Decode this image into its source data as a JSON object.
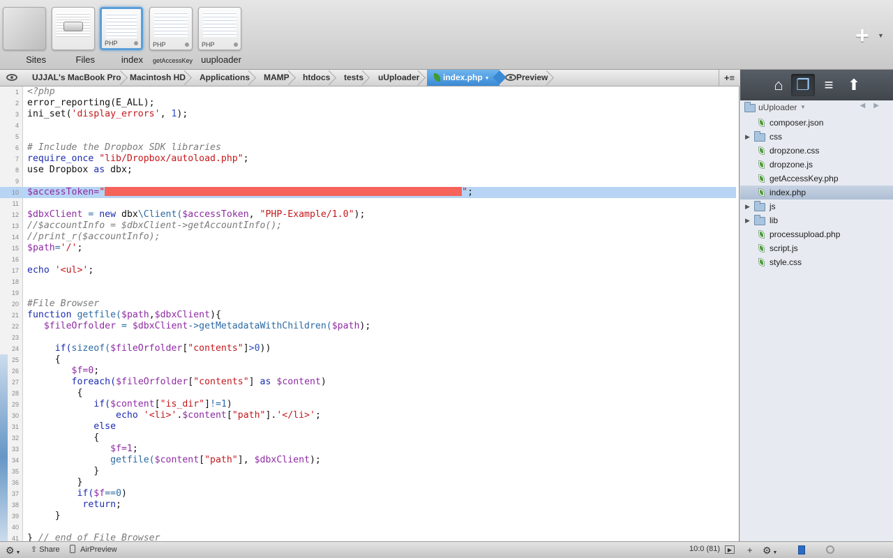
{
  "top_tabs": [
    {
      "label": "Sites",
      "kind": "sites"
    },
    {
      "label": "Files",
      "kind": "files"
    },
    {
      "label": "index",
      "kind": "php",
      "badge": "PHP",
      "selected": true
    },
    {
      "label": "getAccessKey",
      "kind": "php",
      "badge": "PHP"
    },
    {
      "label": "uuploader",
      "kind": "php",
      "badge": "PHP"
    }
  ],
  "new_button_icon": "plus-icon",
  "pathbar": {
    "crumbs": [
      "UJJAL's MacBook Pro",
      "Macintosh HD",
      "Applications",
      "MAMP",
      "htdocs",
      "tests",
      "uUploader"
    ],
    "current_file": "index.php",
    "preview_label": "Preview",
    "add_label": "+≡"
  },
  "editor": {
    "highlighted_line": 10,
    "lines": [
      [
        {
          "t": "<?php",
          "c": "cm"
        }
      ],
      [
        {
          "t": "error_reporting(E_ALL);",
          "c": ""
        }
      ],
      [
        {
          "t": "ini_set(",
          "c": ""
        },
        {
          "t": "'display_errors'",
          "c": "str"
        },
        {
          "t": ", ",
          "c": ""
        },
        {
          "t": "1",
          "c": "num"
        },
        {
          "t": ");",
          "c": ""
        }
      ],
      [],
      [],
      [
        {
          "t": "# Include the Dropbox SDK libraries",
          "c": "cm"
        }
      ],
      [
        {
          "t": "require_once ",
          "c": "kw"
        },
        {
          "t": "\"lib/Dropbox/autoload.php\"",
          "c": "str"
        },
        {
          "t": ";",
          "c": ""
        }
      ],
      [
        {
          "t": "use Dropbox ",
          "c": ""
        },
        {
          "t": "as",
          "c": "kw"
        },
        {
          "t": " dbx;",
          "c": ""
        }
      ],
      [],
      [
        {
          "t": "$accessToken=",
          "c": "var"
        },
        {
          "t": "\"",
          "c": "str"
        },
        {
          "t": "",
          "c": "redact"
        },
        {
          "t": "\"",
          "c": "str"
        },
        {
          "t": ";",
          "c": ""
        }
      ],
      [],
      [
        {
          "t": "$dbxClient",
          "c": "var"
        },
        {
          "t": " = ",
          "c": "fn"
        },
        {
          "t": "new",
          "c": "kw"
        },
        {
          "t": " dbx",
          "c": ""
        },
        {
          "t": "\\Client(",
          "c": "fn"
        },
        {
          "t": "$accessToken",
          "c": "var"
        },
        {
          "t": ", ",
          "c": ""
        },
        {
          "t": "\"PHP-Example/1.0\"",
          "c": "str"
        },
        {
          "t": ");",
          "c": ""
        }
      ],
      [
        {
          "t": "//$accountInfo = $dbxClient->getAccountInfo();",
          "c": "cm"
        }
      ],
      [
        {
          "t": "//print_r($accountInfo);",
          "c": "cm"
        }
      ],
      [
        {
          "t": "$path",
          "c": "var"
        },
        {
          "t": "=",
          "c": "fn"
        },
        {
          "t": "'/'",
          "c": "str"
        },
        {
          "t": ";",
          "c": ""
        }
      ],
      [],
      [
        {
          "t": "echo ",
          "c": "kw"
        },
        {
          "t": "'<ul>'",
          "c": "str"
        },
        {
          "t": ";",
          "c": ""
        }
      ],
      [],
      [],
      [
        {
          "t": "#File Browser",
          "c": "cm"
        }
      ],
      [
        {
          "t": "function ",
          "c": "kw"
        },
        {
          "t": "getfile(",
          "c": "fn"
        },
        {
          "t": "$path",
          "c": "var"
        },
        {
          "t": ",",
          "c": ""
        },
        {
          "t": "$dbxClient",
          "c": "var"
        },
        {
          "t": "){",
          "c": ""
        }
      ],
      [
        {
          "t": "   ",
          "c": ""
        },
        {
          "t": "$fileOrfolder",
          "c": "var"
        },
        {
          "t": " = ",
          "c": "fn"
        },
        {
          "t": "$dbxClient",
          "c": "var"
        },
        {
          "t": "->getMetadataWithChildren(",
          "c": "fn"
        },
        {
          "t": "$path",
          "c": "var"
        },
        {
          "t": ");",
          "c": ""
        }
      ],
      [],
      [
        {
          "t": "     ",
          "c": ""
        },
        {
          "t": "if(",
          "c": "kw"
        },
        {
          "t": "sizeof(",
          "c": "fn"
        },
        {
          "t": "$fileOrfolder",
          "c": "var"
        },
        {
          "t": "[",
          "c": ""
        },
        {
          "t": "\"contents\"",
          "c": "str"
        },
        {
          "t": "]",
          "c": ""
        },
        {
          "t": ">0",
          "c": "num"
        },
        {
          "t": "))",
          "c": ""
        }
      ],
      [
        {
          "t": "     {",
          "c": ""
        }
      ],
      [
        {
          "t": "        ",
          "c": ""
        },
        {
          "t": "$f=0",
          "c": "var"
        },
        {
          "t": ";",
          "c": ""
        }
      ],
      [
        {
          "t": "        ",
          "c": ""
        },
        {
          "t": "foreach(",
          "c": "kw"
        },
        {
          "t": "$fileOrfolder",
          "c": "var"
        },
        {
          "t": "[",
          "c": ""
        },
        {
          "t": "\"contents\"",
          "c": "str"
        },
        {
          "t": "] ",
          "c": ""
        },
        {
          "t": "as",
          "c": "kw"
        },
        {
          "t": " ",
          "c": ""
        },
        {
          "t": "$content",
          "c": "var"
        },
        {
          "t": ")",
          "c": ""
        }
      ],
      [
        {
          "t": "         {",
          "c": ""
        }
      ],
      [
        {
          "t": "            ",
          "c": ""
        },
        {
          "t": "if(",
          "c": "kw"
        },
        {
          "t": "$content",
          "c": "var"
        },
        {
          "t": "[",
          "c": ""
        },
        {
          "t": "\"is_dir\"",
          "c": "str"
        },
        {
          "t": "]",
          "c": ""
        },
        {
          "t": "!=1",
          "c": "fn"
        },
        {
          "t": ")",
          "c": ""
        }
      ],
      [
        {
          "t": "                ",
          "c": ""
        },
        {
          "t": "echo ",
          "c": "kw"
        },
        {
          "t": "'<li>'",
          "c": "str"
        },
        {
          "t": ".",
          "c": ""
        },
        {
          "t": "$content",
          "c": "var"
        },
        {
          "t": "[",
          "c": ""
        },
        {
          "t": "\"path\"",
          "c": "str"
        },
        {
          "t": "].",
          "c": ""
        },
        {
          "t": "'</li>'",
          "c": "str"
        },
        {
          "t": ";",
          "c": ""
        }
      ],
      [
        {
          "t": "            ",
          "c": ""
        },
        {
          "t": "else",
          "c": "kw"
        }
      ],
      [
        {
          "t": "            {",
          "c": ""
        }
      ],
      [
        {
          "t": "               ",
          "c": ""
        },
        {
          "t": "$f=1",
          "c": "var"
        },
        {
          "t": ";",
          "c": ""
        }
      ],
      [
        {
          "t": "               ",
          "c": ""
        },
        {
          "t": "getfile(",
          "c": "fn"
        },
        {
          "t": "$content",
          "c": "var"
        },
        {
          "t": "[",
          "c": ""
        },
        {
          "t": "\"path\"",
          "c": "str"
        },
        {
          "t": "], ",
          "c": ""
        },
        {
          "t": "$dbxClient",
          "c": "var"
        },
        {
          "t": ");",
          "c": ""
        }
      ],
      [
        {
          "t": "            }",
          "c": ""
        }
      ],
      [
        {
          "t": "         }",
          "c": ""
        }
      ],
      [
        {
          "t": "         ",
          "c": ""
        },
        {
          "t": "if(",
          "c": "kw"
        },
        {
          "t": "$f",
          "c": "var"
        },
        {
          "t": "==0",
          "c": "fn"
        },
        {
          "t": ")",
          "c": ""
        }
      ],
      [
        {
          "t": "          ",
          "c": ""
        },
        {
          "t": "return",
          "c": "kw"
        },
        {
          "t": ";",
          "c": ""
        }
      ],
      [
        {
          "t": "     }",
          "c": ""
        }
      ],
      [],
      [
        {
          "t": "} ",
          "c": ""
        },
        {
          "t": "// end of File Browser",
          "c": "cm"
        }
      ]
    ]
  },
  "sidebar": {
    "tools": [
      "home-icon",
      "files-icon",
      "notes-icon",
      "upload-icon"
    ],
    "folder_name": "uUploader",
    "items": [
      {
        "name": "composer.json",
        "type": "file"
      },
      {
        "name": "css",
        "type": "folder"
      },
      {
        "name": "dropzone.css",
        "type": "file"
      },
      {
        "name": "dropzone.js",
        "type": "file"
      },
      {
        "name": "getAccessKey.php",
        "type": "file"
      },
      {
        "name": "index.php",
        "type": "file",
        "selected": true
      },
      {
        "name": "js",
        "type": "folder"
      },
      {
        "name": "lib",
        "type": "folder"
      },
      {
        "name": "processupload.php",
        "type": "file"
      },
      {
        "name": "script.js",
        "type": "file"
      },
      {
        "name": "style.css",
        "type": "file"
      }
    ]
  },
  "statusbar": {
    "share_label": "Share",
    "airpreview_label": "AirPreview",
    "cursor_position": "10:0 (81)"
  }
}
